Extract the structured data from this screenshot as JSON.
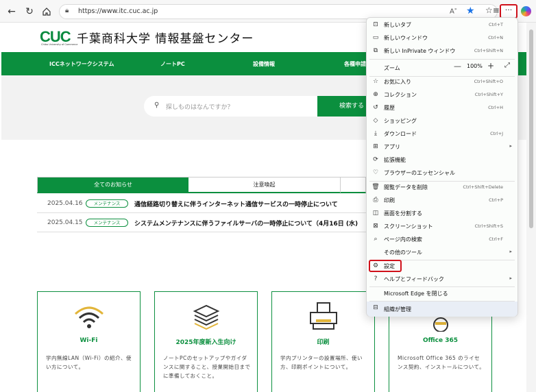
{
  "browser": {
    "url": "https://www.itc.cuc.ac.jp",
    "more_label": "···",
    "icons": {
      "back": "back-arrow-icon",
      "refresh": "refresh-icon",
      "home": "home-icon",
      "lock": "lock-icon",
      "read_aloud": "read-aloud-icon",
      "favorite": "star-icon",
      "favorites": "favorites-icon",
      "copilot": "copilot-icon"
    }
  },
  "site": {
    "logo_mark": "CUC",
    "logo_sub": "Chiba University of Commerce",
    "title": "千葉商科大学 情報基盤センター",
    "nav": [
      "ICCネットワークシステム",
      "ノートPC",
      "設備情報",
      "各種申請"
    ],
    "search": {
      "placeholder": "探しものはなんですか？",
      "button": "検索する"
    },
    "tabs": [
      "全てのお知らせ",
      "注意喚起"
    ],
    "news": [
      {
        "date": "2025.04.16",
        "badge": "メンテナンス",
        "title": "通信経路切り替えに伴うインターネット通信サービスの一時停止について"
      },
      {
        "date": "2025.04.15",
        "badge": "メンテナンス",
        "title": "システムメンテナンスに伴うファイルサーバの一時停止について（4月16日 (水)"
      }
    ],
    "cards": [
      {
        "title": "Wi-Fi",
        "desc": "学内無線LAN（Wi-Fi）の紹介、使い方について。",
        "icon": "wifi-icon"
      },
      {
        "title": "2025年度新入生向け",
        "desc": "ノートPCのセットアップやガイダンスに関すること、授業開始日までに準備しておくこと。",
        "icon": "books-icon"
      },
      {
        "title": "印刷",
        "desc": "学内プリンターの設置場所、使い方、印刷ポイントについて。",
        "icon": "printer-icon"
      },
      {
        "title": "Office 365",
        "desc": "Microsoft Office 365 のライセンス契約、インストールについて。",
        "icon": "office-icon"
      }
    ]
  },
  "menu": {
    "items": [
      {
        "label": "新しいタブ",
        "shortcut": "Ctrl+T",
        "icon": "new-tab-icon"
      },
      {
        "label": "新しいウィンドウ",
        "shortcut": "Ctrl+N",
        "icon": "new-window-icon"
      },
      {
        "label": "新しい InPrivate ウィンドウ",
        "shortcut": "Ctrl+Shift+N",
        "icon": "inprivate-icon"
      },
      {
        "label": "お気に入り",
        "shortcut": "Ctrl+Shift+O",
        "icon": "favorites-icon"
      },
      {
        "label": "コレクション",
        "shortcut": "Ctrl+Shift+Y",
        "icon": "collections-icon"
      },
      {
        "label": "履歴",
        "shortcut": "Ctrl+H",
        "icon": "history-icon"
      },
      {
        "label": "ショッピング",
        "shortcut": "",
        "icon": "shopping-tag-icon"
      },
      {
        "label": "ダウンロード",
        "shortcut": "Ctrl+J",
        "icon": "download-icon"
      },
      {
        "label": "アプリ",
        "shortcut": "",
        "icon": "apps-icon"
      },
      {
        "label": "拡張機能",
        "shortcut": "",
        "icon": "extensions-icon"
      },
      {
        "label": "ブラウザーのエッセンシャル",
        "shortcut": "",
        "icon": "heart-pulse-icon"
      },
      {
        "label": "閲覧データを削除",
        "shortcut": "Ctrl+Shift+Delete",
        "icon": "trash-icon"
      },
      {
        "label": "印刷",
        "shortcut": "Ctrl+P",
        "icon": "print-icon"
      },
      {
        "label": "画面を分割する",
        "shortcut": "",
        "icon": "split-screen-icon"
      },
      {
        "label": "スクリーンショット",
        "shortcut": "Ctrl+Shift+S",
        "icon": "screenshot-icon"
      },
      {
        "label": "ページ内の検索",
        "shortcut": "Ctrl+F",
        "icon": "find-icon"
      },
      {
        "label": "その他のツール",
        "shortcut": "",
        "icon": ""
      },
      {
        "label": "設定",
        "shortcut": "",
        "icon": "gear-icon"
      },
      {
        "label": "ヘルプとフィードバック",
        "shortcut": "",
        "icon": "help-icon"
      },
      {
        "label": "Microsoft Edge を閉じる",
        "shortcut": "",
        "icon": ""
      },
      {
        "label": "組織が管理",
        "shortcut": "",
        "icon": "briefcase-icon"
      }
    ],
    "zoom": {
      "label": "ズーム",
      "value": "100%",
      "minus": "—",
      "plus": "+"
    }
  }
}
